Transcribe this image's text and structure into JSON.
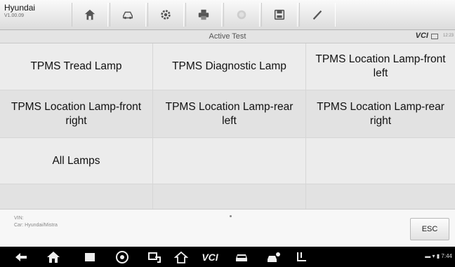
{
  "header": {
    "make": "Hyundai",
    "version": "V1.00.09",
    "toolbar_icons": [
      "home-icon",
      "vehicle-swap-icon",
      "settings-icon",
      "print-icon",
      "help-icon",
      "save-icon",
      "edit-icon"
    ]
  },
  "titlebar": {
    "title": "Active Test",
    "vci": "VCI",
    "time": "12:23"
  },
  "grid": {
    "items": [
      "TPMS Tread Lamp",
      "TPMS Diagnostic Lamp",
      "TPMS Location Lamp-front left",
      "TPMS Location Lamp-front right",
      "TPMS Location Lamp-rear left",
      "TPMS Location Lamp-rear right",
      "All Lamps"
    ]
  },
  "footer": {
    "vin_label": "VIN:",
    "car_label": "Car: Hyundai/Mistra",
    "esc_label": "ESC"
  },
  "navbar": {
    "vcl_label": "VCI",
    "status": "7:44"
  }
}
